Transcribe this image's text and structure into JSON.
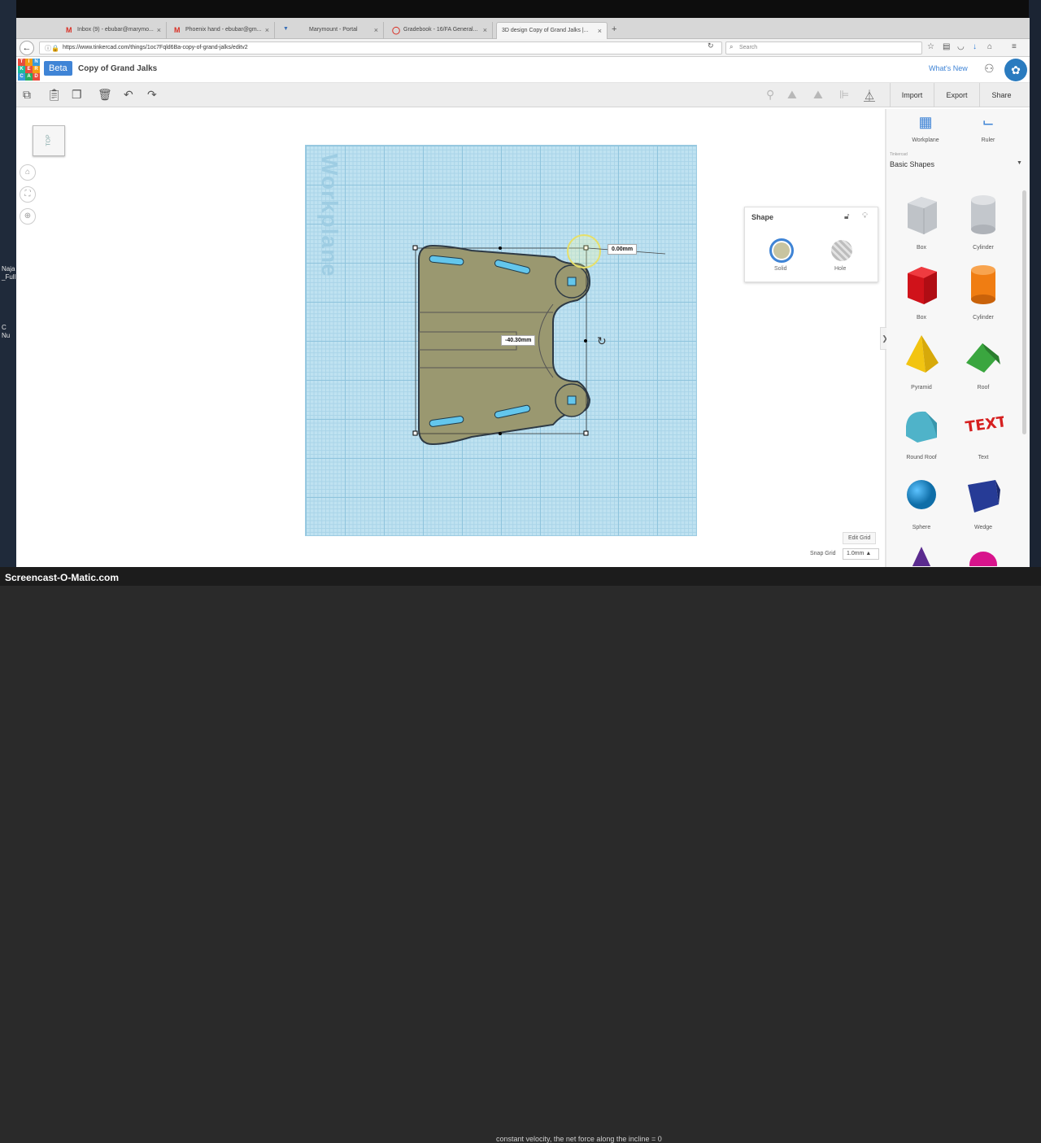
{
  "desktop": {
    "left_fragments": [
      "Naja",
      "_Full",
      "C",
      "Nu"
    ],
    "watermark": "Screencast-O-Matic.com",
    "bottom_text": "constant velocity, the net force along the incline = 0"
  },
  "browser": {
    "tabs": [
      {
        "icon": "M",
        "label": "Inbox (9) - ebubar@marymo...",
        "active": false
      },
      {
        "icon": "M",
        "label": "Phoenix hand - ebubar@gm...",
        "active": false
      },
      {
        "icon": "▼",
        "label": "Marymount - Portal",
        "active": false
      },
      {
        "icon": "◯",
        "label": "Gradebook - 16/FA General...",
        "active": false
      },
      {
        "icon": "",
        "label": "3D design Copy of Grand Jalks |...",
        "active": true
      }
    ],
    "url": "https://www.tinkercad.com/things/1oc7Fqld6Ba-copy-of-grand-jalks/editv2",
    "search_placeholder": "Search"
  },
  "header": {
    "logo_letters": [
      "T",
      "I",
      "N",
      "K",
      "E",
      "R",
      "C",
      "A",
      "D"
    ],
    "beta": "Beta",
    "title": "Copy of Grand Jalks",
    "whats_new": "What's New"
  },
  "toolbar": {
    "import": "Import",
    "export": "Export",
    "share": "Share"
  },
  "canvas": {
    "viewcube_label": "TOP",
    "workplane_label": "Workplane",
    "dim_top": "0.00mm",
    "dim_width": "-40.30mm",
    "edit_grid": "Edit Grid",
    "snap_label": "Snap Grid",
    "snap_value": "1.0mm ▲"
  },
  "shape_panel": {
    "title": "Shape",
    "solid": "Solid",
    "hole": "Hole",
    "solid_color": "#c8c4a0"
  },
  "right_panel": {
    "workplane": "Workplane",
    "ruler": "Ruler",
    "category_sub": "Tinkercad",
    "category": "Basic Shapes",
    "shapes": [
      {
        "name": "Box",
        "color": "#bfc3c8"
      },
      {
        "name": "Cylinder",
        "color": "#c3c7cc"
      },
      {
        "name": "Box",
        "color": "#e3141b"
      },
      {
        "name": "Cylinder",
        "color": "#f07d12"
      },
      {
        "name": "Pyramid",
        "color": "#f2c411"
      },
      {
        "name": "Roof",
        "color": "#3aa63f"
      },
      {
        "name": "Round Roof",
        "color": "#4fb3c9"
      },
      {
        "name": "Text",
        "color": "#d62020"
      },
      {
        "name": "Sphere",
        "color": "#1b8fd6"
      },
      {
        "name": "Wedge",
        "color": "#263b96"
      }
    ],
    "partial_colors": [
      "#5b2b8f",
      "#d8148c"
    ]
  },
  "colors": {
    "accent": "#3f84d6",
    "workplane": "#bfe2f1",
    "shape_fill": "#9a9870"
  }
}
